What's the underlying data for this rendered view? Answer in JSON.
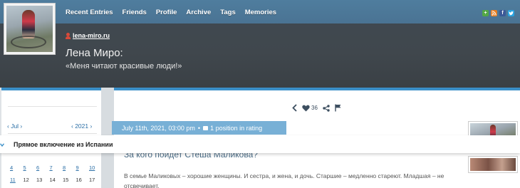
{
  "header": {
    "nav": [
      "Recent Entries",
      "Friends",
      "Profile",
      "Archive",
      "Tags",
      "Memories"
    ],
    "site_link": "lena-miro.ru",
    "title": "Лена Миро:",
    "subtitle": "«Меня читают красивые люди!»",
    "social_icons": [
      "add-icon",
      "rss-icon",
      "facebook-icon",
      "twitter-icon"
    ],
    "social_glyphs": [
      "+",
      "",
      "f",
      ""
    ]
  },
  "sidebar": {
    "month_nav": "‹ Jul ›",
    "year_nav": "‹ 2021 ›",
    "calendar": {
      "row1": [
        "4",
        "5",
        "6",
        "7",
        "8",
        "9",
        "10"
      ],
      "row2": [
        "11",
        "12",
        "13",
        "14",
        "15",
        "16",
        "17"
      ]
    }
  },
  "post": {
    "like_count": "36",
    "date": "July 11th, 2021, 03:00 pm",
    "rating": "1 position in rating",
    "title": "За кого пойдет Стеша Маликова?",
    "body": "В семье Маликовых – хорошие женщины. И сестра, и жена, и дочь. Старшие – медленно стареют. Младшая – не отсвечивает."
  },
  "overlay": {
    "title": "Прямое включение из Испании"
  },
  "colors": {
    "nav_bar": "#4f7d9e",
    "accent_blue": "#3a8fc8",
    "date_bar": "#78b0d6",
    "header_bg": "#40474d"
  }
}
